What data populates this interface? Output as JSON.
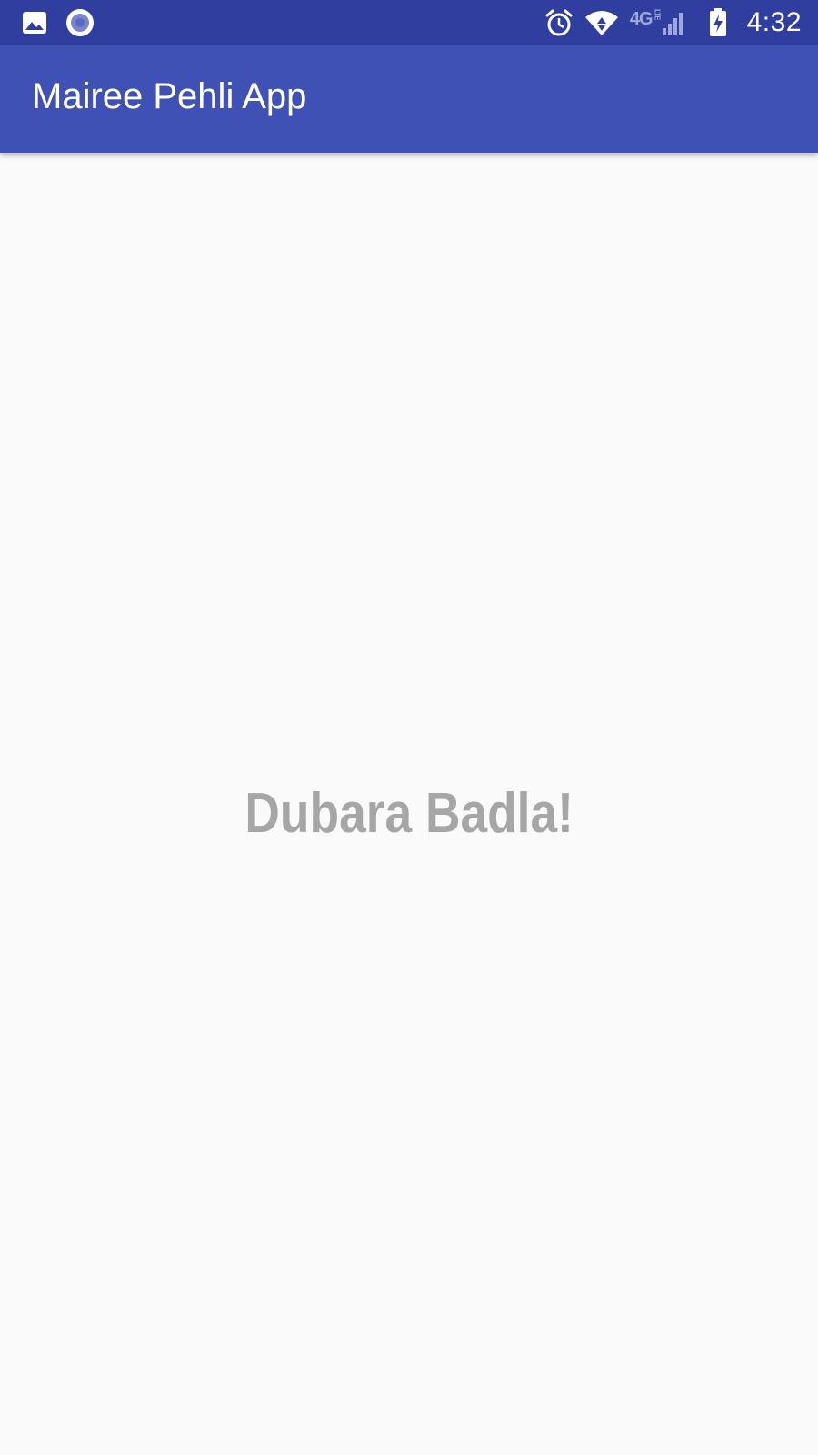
{
  "status_bar": {
    "left_icons": [
      "image-notification-icon",
      "record-circle-notification-icon"
    ],
    "right_icons": [
      "alarm-icon",
      "wifi-icon",
      "4g-lte-icon",
      "cell-signal-icon",
      "battery-charging-icon"
    ],
    "time": "4:32",
    "network_label": "4G",
    "network_sub_label": "LTE"
  },
  "app_bar": {
    "title": "Mairee Pehli App"
  },
  "main": {
    "message": "Dubara Badla!"
  },
  "colors": {
    "status_bar": "#303F9F",
    "app_bar": "#3F51B5",
    "background": "#FAFAFA",
    "message_text": "#A6A6A6",
    "icon_white": "#FFFFFF"
  }
}
